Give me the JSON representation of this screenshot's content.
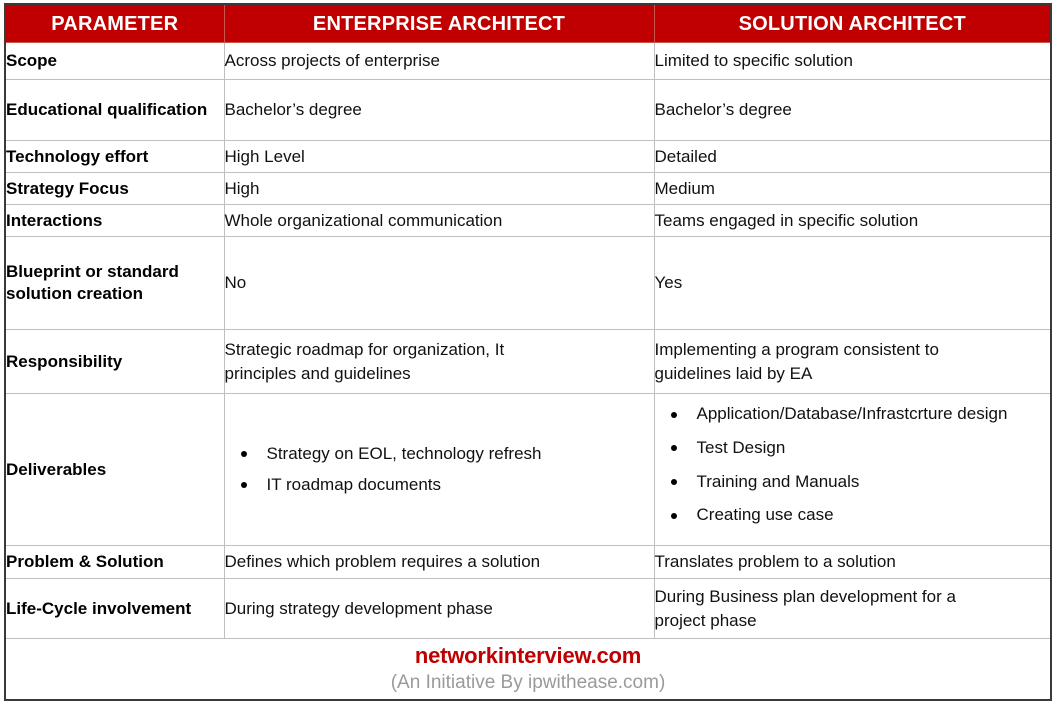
{
  "watermark": "ipwithease.com",
  "table": {
    "headers": [
      {
        "label": "PARAMETER"
      },
      {
        "label": "ENTERPRISE ARCHITECT"
      },
      {
        "label": "SOLUTION ARCHITECT"
      }
    ],
    "rows": [
      {
        "parameter": "Scope",
        "enterprise": "Across projects of enterprise",
        "solution": "Limited to specific solution"
      },
      {
        "parameter_lines": [
          "Educational",
          "qualification"
        ],
        "parameter": "Educational qualification",
        "enterprise": "Bachelor’s degree",
        "solution": "Bachelor’s degree"
      },
      {
        "parameter": "Technology effort",
        "enterprise": "High Level",
        "solution": "Detailed"
      },
      {
        "parameter": "Strategy Focus",
        "enterprise": "High",
        "solution": "Medium"
      },
      {
        "parameter": "Interactions",
        "enterprise": "Whole organizational communication",
        "solution": "Teams engaged in specific solution"
      },
      {
        "parameter_lines": [
          "Blueprint or",
          "standard solution",
          "creation"
        ],
        "parameter": "Blueprint or standard solution creation",
        "enterprise": "No",
        "solution": "Yes"
      },
      {
        "parameter": "Responsibility",
        "enterprise_lines": [
          "Strategic roadmap for organization, It",
          "principles and guidelines"
        ],
        "enterprise": "Strategic roadmap for organization, It principles and guidelines",
        "solution_lines": [
          "Implementing a program consistent to",
          "guidelines laid by EA"
        ],
        "solution": "Implementing a program consistent to guidelines laid by EA"
      },
      {
        "parameter": "Deliverables",
        "enterprise_bullets": [
          "Strategy on EOL, technology refresh",
          "IT roadmap documents"
        ],
        "solution_bullets": [
          "Application/Database/Infrastcrture design",
          "Test Design",
          "Training and Manuals",
          "Creating use case"
        ]
      },
      {
        "parameter": "Problem & Solution",
        "enterprise": "Defines which problem requires a solution",
        "solution": "Translates problem to a solution"
      },
      {
        "parameter_lines": [
          "Life-Cycle",
          "involvement"
        ],
        "parameter": "Life-Cycle involvement",
        "enterprise": "During strategy development phase",
        "solution_lines": [
          "During Business plan development for a",
          "project phase"
        ],
        "solution": "During Business plan development for a project phase"
      }
    ],
    "footer": {
      "brand": "networkinterview.com",
      "subbrand": "(An Initiative By ipwithease.com)"
    }
  },
  "colors": {
    "header_red": "#C00000",
    "brand_red": "#C00000",
    "subbrand_gray": "#9A9A9A",
    "grid_gray": "#BFBFBF",
    "outer_border": "#3A3A3A",
    "watermark_gray": "#E2E2E2"
  }
}
